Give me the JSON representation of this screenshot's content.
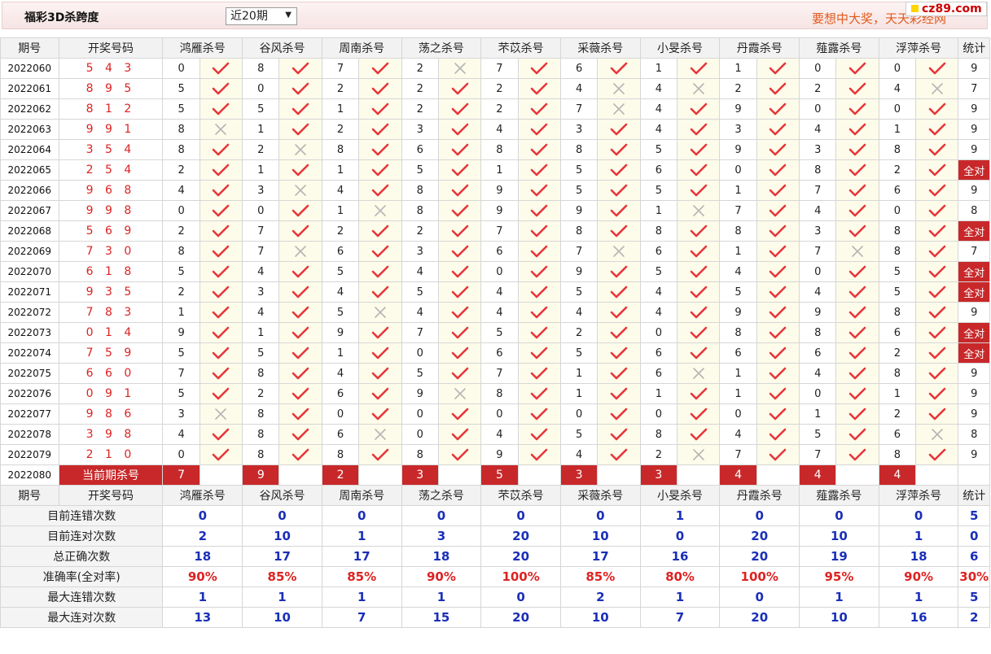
{
  "header": {
    "title": "福彩3D杀跨度",
    "period_selected": "近20期",
    "slogan": "要想中大奖，天天彩经网",
    "site": "cz89.com"
  },
  "columns": [
    "期号",
    "开奖号码",
    "鸿雁杀号",
    "谷风杀号",
    "周南杀号",
    "荡之杀号",
    "芣苡杀号",
    "采薇杀号",
    "小旻杀号",
    "丹霞杀号",
    "薤露杀号",
    "浮萍杀号",
    "统计"
  ],
  "all_correct_label": "全对",
  "rows": [
    {
      "issue": "2022060",
      "draw": "5 4 3",
      "kills": [
        [
          0,
          1
        ],
        [
          8,
          1
        ],
        [
          7,
          1
        ],
        [
          2,
          0
        ],
        [
          7,
          1
        ],
        [
          6,
          1
        ],
        [
          1,
          1
        ],
        [
          1,
          1
        ],
        [
          0,
          1
        ],
        [
          0,
          1
        ]
      ],
      "stat": "9"
    },
    {
      "issue": "2022061",
      "draw": "8 9 5",
      "kills": [
        [
          5,
          1
        ],
        [
          0,
          1
        ],
        [
          2,
          1
        ],
        [
          2,
          1
        ],
        [
          2,
          1
        ],
        [
          4,
          0
        ],
        [
          4,
          0
        ],
        [
          2,
          1
        ],
        [
          2,
          1
        ],
        [
          4,
          0
        ]
      ],
      "stat": "7"
    },
    {
      "issue": "2022062",
      "draw": "8 1 2",
      "kills": [
        [
          5,
          1
        ],
        [
          5,
          1
        ],
        [
          1,
          1
        ],
        [
          2,
          1
        ],
        [
          2,
          1
        ],
        [
          7,
          0
        ],
        [
          4,
          1
        ],
        [
          9,
          1
        ],
        [
          0,
          1
        ],
        [
          0,
          1
        ]
      ],
      "stat": "9"
    },
    {
      "issue": "2022063",
      "draw": "9 9 1",
      "kills": [
        [
          8,
          0
        ],
        [
          1,
          1
        ],
        [
          2,
          1
        ],
        [
          3,
          1
        ],
        [
          4,
          1
        ],
        [
          3,
          1
        ],
        [
          4,
          1
        ],
        [
          3,
          1
        ],
        [
          4,
          1
        ],
        [
          1,
          1
        ]
      ],
      "stat": "9"
    },
    {
      "issue": "2022064",
      "draw": "3 5 4",
      "kills": [
        [
          8,
          1
        ],
        [
          2,
          0
        ],
        [
          8,
          1
        ],
        [
          6,
          1
        ],
        [
          8,
          1
        ],
        [
          8,
          1
        ],
        [
          5,
          1
        ],
        [
          9,
          1
        ],
        [
          3,
          1
        ],
        [
          8,
          1
        ]
      ],
      "stat": "9"
    },
    {
      "issue": "2022065",
      "draw": "2 5 4",
      "kills": [
        [
          2,
          1
        ],
        [
          1,
          1
        ],
        [
          1,
          1
        ],
        [
          5,
          1
        ],
        [
          1,
          1
        ],
        [
          5,
          1
        ],
        [
          6,
          1
        ],
        [
          0,
          1
        ],
        [
          8,
          1
        ],
        [
          2,
          1
        ]
      ],
      "stat": "全对"
    },
    {
      "issue": "2022066",
      "draw": "9 6 8",
      "kills": [
        [
          4,
          1
        ],
        [
          3,
          0
        ],
        [
          4,
          1
        ],
        [
          8,
          1
        ],
        [
          9,
          1
        ],
        [
          5,
          1
        ],
        [
          5,
          1
        ],
        [
          1,
          1
        ],
        [
          7,
          1
        ],
        [
          6,
          1
        ]
      ],
      "stat": "9"
    },
    {
      "issue": "2022067",
      "draw": "9 9 8",
      "kills": [
        [
          0,
          1
        ],
        [
          0,
          1
        ],
        [
          1,
          0
        ],
        [
          8,
          1
        ],
        [
          9,
          1
        ],
        [
          9,
          1
        ],
        [
          1,
          0
        ],
        [
          7,
          1
        ],
        [
          4,
          1
        ],
        [
          0,
          1
        ]
      ],
      "stat": "8"
    },
    {
      "issue": "2022068",
      "draw": "5 6 9",
      "kills": [
        [
          2,
          1
        ],
        [
          7,
          1
        ],
        [
          2,
          1
        ],
        [
          2,
          1
        ],
        [
          7,
          1
        ],
        [
          8,
          1
        ],
        [
          8,
          1
        ],
        [
          8,
          1
        ],
        [
          3,
          1
        ],
        [
          8,
          1
        ]
      ],
      "stat": "全对"
    },
    {
      "issue": "2022069",
      "draw": "7 3 0",
      "kills": [
        [
          8,
          1
        ],
        [
          7,
          0
        ],
        [
          6,
          1
        ],
        [
          3,
          1
        ],
        [
          6,
          1
        ],
        [
          7,
          0
        ],
        [
          6,
          1
        ],
        [
          1,
          1
        ],
        [
          7,
          0
        ],
        [
          8,
          1
        ]
      ],
      "stat": "7"
    },
    {
      "issue": "2022070",
      "draw": "6 1 8",
      "kills": [
        [
          5,
          1
        ],
        [
          4,
          1
        ],
        [
          5,
          1
        ],
        [
          4,
          1
        ],
        [
          0,
          1
        ],
        [
          9,
          1
        ],
        [
          5,
          1
        ],
        [
          4,
          1
        ],
        [
          0,
          1
        ],
        [
          5,
          1
        ]
      ],
      "stat": "全对"
    },
    {
      "issue": "2022071",
      "draw": "9 3 5",
      "kills": [
        [
          2,
          1
        ],
        [
          3,
          1
        ],
        [
          4,
          1
        ],
        [
          5,
          1
        ],
        [
          4,
          1
        ],
        [
          5,
          1
        ],
        [
          4,
          1
        ],
        [
          5,
          1
        ],
        [
          4,
          1
        ],
        [
          5,
          1
        ]
      ],
      "stat": "全对"
    },
    {
      "issue": "2022072",
      "draw": "7 8 3",
      "kills": [
        [
          1,
          1
        ],
        [
          4,
          1
        ],
        [
          5,
          0
        ],
        [
          4,
          1
        ],
        [
          4,
          1
        ],
        [
          4,
          1
        ],
        [
          4,
          1
        ],
        [
          9,
          1
        ],
        [
          9,
          1
        ],
        [
          8,
          1
        ]
      ],
      "stat": "9"
    },
    {
      "issue": "2022073",
      "draw": "0 1 4",
      "kills": [
        [
          9,
          1
        ],
        [
          1,
          1
        ],
        [
          9,
          1
        ],
        [
          7,
          1
        ],
        [
          5,
          1
        ],
        [
          2,
          1
        ],
        [
          0,
          1
        ],
        [
          8,
          1
        ],
        [
          8,
          1
        ],
        [
          6,
          1
        ]
      ],
      "stat": "全对"
    },
    {
      "issue": "2022074",
      "draw": "7 5 9",
      "kills": [
        [
          5,
          1
        ],
        [
          5,
          1
        ],
        [
          1,
          1
        ],
        [
          0,
          1
        ],
        [
          6,
          1
        ],
        [
          5,
          1
        ],
        [
          6,
          1
        ],
        [
          6,
          1
        ],
        [
          6,
          1
        ],
        [
          2,
          1
        ]
      ],
      "stat": "全对"
    },
    {
      "issue": "2022075",
      "draw": "6 6 0",
      "kills": [
        [
          7,
          1
        ],
        [
          8,
          1
        ],
        [
          4,
          1
        ],
        [
          5,
          1
        ],
        [
          7,
          1
        ],
        [
          1,
          1
        ],
        [
          6,
          0
        ],
        [
          1,
          1
        ],
        [
          4,
          1
        ],
        [
          8,
          1
        ]
      ],
      "stat": "9"
    },
    {
      "issue": "2022076",
      "draw": "0 9 1",
      "kills": [
        [
          5,
          1
        ],
        [
          2,
          1
        ],
        [
          6,
          1
        ],
        [
          9,
          0
        ],
        [
          8,
          1
        ],
        [
          1,
          1
        ],
        [
          1,
          1
        ],
        [
          1,
          1
        ],
        [
          0,
          1
        ],
        [
          1,
          1
        ]
      ],
      "stat": "9"
    },
    {
      "issue": "2022077",
      "draw": "9 8 6",
      "kills": [
        [
          3,
          0
        ],
        [
          8,
          1
        ],
        [
          0,
          1
        ],
        [
          0,
          1
        ],
        [
          0,
          1
        ],
        [
          0,
          1
        ],
        [
          0,
          1
        ],
        [
          0,
          1
        ],
        [
          1,
          1
        ],
        [
          2,
          1
        ]
      ],
      "stat": "9"
    },
    {
      "issue": "2022078",
      "draw": "3 9 8",
      "kills": [
        [
          4,
          1
        ],
        [
          8,
          1
        ],
        [
          6,
          0
        ],
        [
          0,
          1
        ],
        [
          4,
          1
        ],
        [
          5,
          1
        ],
        [
          8,
          1
        ],
        [
          4,
          1
        ],
        [
          5,
          1
        ],
        [
          6,
          0
        ]
      ],
      "stat": "8"
    },
    {
      "issue": "2022079",
      "draw": "2 1 0",
      "kills": [
        [
          0,
          1
        ],
        [
          8,
          1
        ],
        [
          8,
          1
        ],
        [
          8,
          1
        ],
        [
          9,
          1
        ],
        [
          4,
          1
        ],
        [
          2,
          0
        ],
        [
          7,
          1
        ],
        [
          7,
          1
        ],
        [
          8,
          1
        ]
      ],
      "stat": "9"
    }
  ],
  "current": {
    "issue": "2022080",
    "label": "当前期杀号",
    "kills": [
      "7",
      "9",
      "2",
      "3",
      "5",
      "3",
      "3",
      "4",
      "4",
      "4"
    ]
  },
  "summary": [
    {
      "label": "目前连错次数",
      "values": [
        "0",
        "0",
        "0",
        "0",
        "0",
        "0",
        "1",
        "0",
        "0",
        "0",
        "5"
      ]
    },
    {
      "label": "目前连对次数",
      "values": [
        "2",
        "10",
        "1",
        "3",
        "20",
        "10",
        "0",
        "20",
        "10",
        "1",
        "0"
      ]
    },
    {
      "label": "总正确次数",
      "values": [
        "18",
        "17",
        "17",
        "18",
        "20",
        "17",
        "16",
        "20",
        "19",
        "18",
        "6"
      ]
    },
    {
      "label": "准确率(全对率)",
      "values": [
        "90%",
        "85%",
        "85%",
        "90%",
        "100%",
        "85%",
        "80%",
        "100%",
        "95%",
        "90%",
        "30%"
      ],
      "rate": true
    },
    {
      "label": "最大连错次数",
      "values": [
        "1",
        "1",
        "1",
        "1",
        "0",
        "2",
        "1",
        "0",
        "1",
        "1",
        "5"
      ]
    },
    {
      "label": "最大连对次数",
      "values": [
        "13",
        "10",
        "7",
        "15",
        "20",
        "10",
        "7",
        "20",
        "10",
        "16",
        "2"
      ]
    }
  ],
  "colors": {
    "check": "#e8363a",
    "cross": "#b5b5b5",
    "accent": "#c8282a",
    "blue": "#1a2fb8"
  }
}
